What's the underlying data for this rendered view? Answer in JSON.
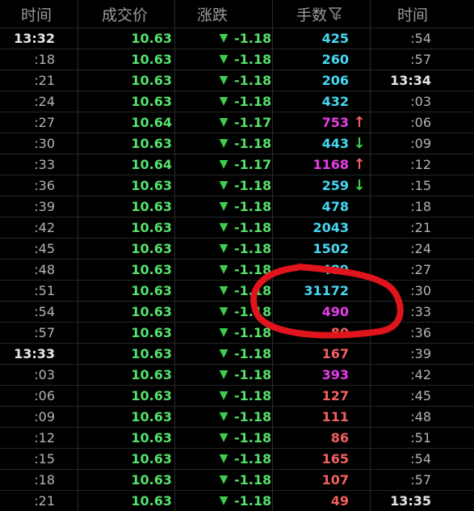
{
  "header": {
    "time": "时间",
    "price": "成交价",
    "change": "涨跌",
    "volume": "手数",
    "time2": "时间",
    "filter_icon": "filter-icon"
  },
  "colors": {
    "price_green": "#55e06a",
    "volume_cyan": "#45d8f2",
    "volume_magenta": "#e83ce8",
    "volume_red": "#f26060",
    "annotation_red": "#e0141c"
  },
  "rows": [
    {
      "time": "13:32",
      "price": "10.63",
      "arrow": "▼",
      "change": "-1.18",
      "volume": "425",
      "vol_color": "cyan",
      "dir": "",
      "time2": ":54"
    },
    {
      "time": ":18",
      "price": "10.63",
      "arrow": "▼",
      "change": "-1.18",
      "volume": "260",
      "vol_color": "cyan",
      "dir": "",
      "time2": ":57"
    },
    {
      "time": ":21",
      "price": "10.63",
      "arrow": "▼",
      "change": "-1.18",
      "volume": "206",
      "vol_color": "cyan",
      "dir": "",
      "time2": "13:34"
    },
    {
      "time": ":24",
      "price": "10.63",
      "arrow": "▼",
      "change": "-1.18",
      "volume": "432",
      "vol_color": "cyan",
      "dir": "",
      "time2": ":03"
    },
    {
      "time": ":27",
      "price": "10.64",
      "arrow": "▼",
      "change": "-1.17",
      "volume": "753",
      "vol_color": "magenta",
      "dir": "↑",
      "time2": ":06"
    },
    {
      "time": ":30",
      "price": "10.63",
      "arrow": "▼",
      "change": "-1.18",
      "volume": "443",
      "vol_color": "cyan",
      "dir": "↓",
      "time2": ":09"
    },
    {
      "time": ":33",
      "price": "10.64",
      "arrow": "▼",
      "change": "-1.17",
      "volume": "1168",
      "vol_color": "magenta",
      "dir": "↑",
      "time2": ":12"
    },
    {
      "time": ":36",
      "price": "10.63",
      "arrow": "▼",
      "change": "-1.18",
      "volume": "259",
      "vol_color": "cyan",
      "dir": "↓",
      "time2": ":15"
    },
    {
      "time": ":39",
      "price": "10.63",
      "arrow": "▼",
      "change": "-1.18",
      "volume": "478",
      "vol_color": "cyan",
      "dir": "",
      "time2": ":18"
    },
    {
      "time": ":42",
      "price": "10.63",
      "arrow": "▼",
      "change": "-1.18",
      "volume": "2043",
      "vol_color": "cyan",
      "dir": "",
      "time2": ":21"
    },
    {
      "time": ":45",
      "price": "10.63",
      "arrow": "▼",
      "change": "-1.18",
      "volume": "1502",
      "vol_color": "cyan",
      "dir": "",
      "time2": ":24"
    },
    {
      "time": ":48",
      "price": "10.63",
      "arrow": "▼",
      "change": "-1.18",
      "volume": "489",
      "vol_color": "cyan",
      "dir": "",
      "time2": ":27"
    },
    {
      "time": ":51",
      "price": "10.63",
      "arrow": "▼",
      "change": "-1.18",
      "volume": "31172",
      "vol_color": "cyan",
      "dir": "",
      "time2": ":30"
    },
    {
      "time": ":54",
      "price": "10.63",
      "arrow": "▼",
      "change": "-1.18",
      "volume": "490",
      "vol_color": "magenta",
      "dir": "",
      "time2": ":33"
    },
    {
      "time": ":57",
      "price": "10.63",
      "arrow": "▼",
      "change": "-1.18",
      "volume": "80",
      "vol_color": "red",
      "dir": "",
      "time2": ":36"
    },
    {
      "time": "13:33",
      "price": "10.63",
      "arrow": "▼",
      "change": "-1.18",
      "volume": "167",
      "vol_color": "red",
      "dir": "",
      "time2": ":39"
    },
    {
      "time": ":03",
      "price": "10.63",
      "arrow": "▼",
      "change": "-1.18",
      "volume": "393",
      "vol_color": "magenta",
      "dir": "",
      "time2": ":42"
    },
    {
      "time": ":06",
      "price": "10.63",
      "arrow": "▼",
      "change": "-1.18",
      "volume": "127",
      "vol_color": "red",
      "dir": "",
      "time2": ":45"
    },
    {
      "time": ":09",
      "price": "10.63",
      "arrow": "▼",
      "change": "-1.18",
      "volume": "111",
      "vol_color": "red",
      "dir": "",
      "time2": ":48"
    },
    {
      "time": ":12",
      "price": "10.63",
      "arrow": "▼",
      "change": "-1.18",
      "volume": "86",
      "vol_color": "red",
      "dir": "",
      "time2": ":51"
    },
    {
      "time": ":15",
      "price": "10.63",
      "arrow": "▼",
      "change": "-1.18",
      "volume": "165",
      "vol_color": "red",
      "dir": "",
      "time2": ":54"
    },
    {
      "time": ":18",
      "price": "10.63",
      "arrow": "▼",
      "change": "-1.18",
      "volume": "107",
      "vol_color": "red",
      "dir": "",
      "time2": ":57"
    },
    {
      "time": ":21",
      "price": "10.63",
      "arrow": "▼",
      "change": "-1.18",
      "volume": "49",
      "vol_color": "red",
      "dir": "",
      "time2": "13:35"
    }
  ]
}
